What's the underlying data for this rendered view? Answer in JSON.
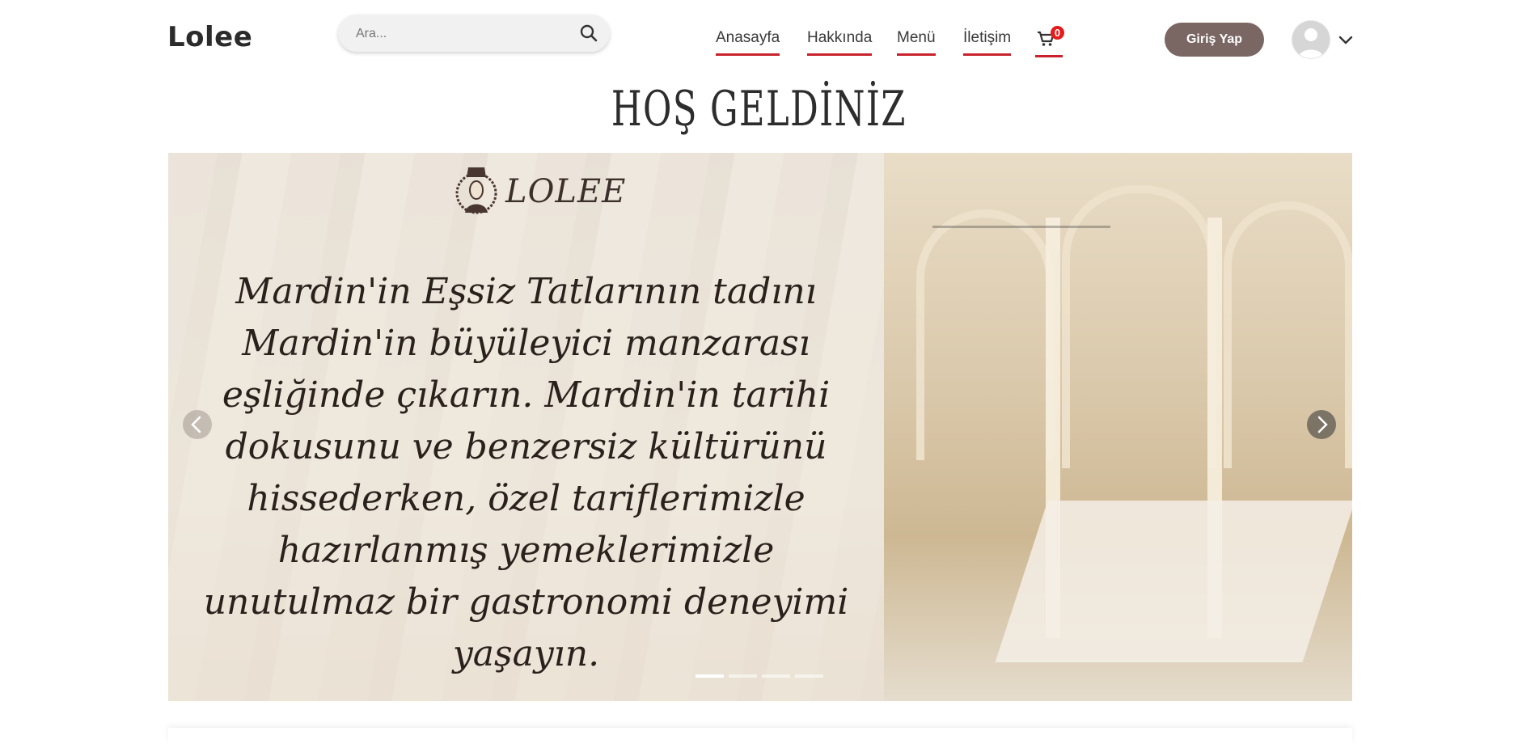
{
  "header": {
    "logo": "Lolee",
    "search_placeholder": "Ara...",
    "nav": [
      {
        "label": "Anasayfa"
      },
      {
        "label": "Hakkında"
      },
      {
        "label": "Menü"
      },
      {
        "label": "İletişim"
      }
    ],
    "cart_count": "0",
    "login_label": "Giriş Yap",
    "avatar_icon": "user-avatar-icon"
  },
  "hero": {
    "title": "HOŞ GELDİNİZ",
    "brand": "LOLEE",
    "slide_text": "Mardin'in Eşsiz Tatlarının tadını Mardin'in büyüleyici manzarası eşliğinde çıkarın. Mardin'in tarihi dokusunu ve benzersiz kültürünü hissederken, özel tariflerimizle hazırlanmış yemeklerimizle unutulmaz bir gastronomi deneyimi yaşayın.",
    "slide_count": 4,
    "active_slide": 1
  },
  "colors": {
    "nav_underline": "#c8232c",
    "login_button": "#7a6663",
    "badge": "#e51b1b"
  }
}
